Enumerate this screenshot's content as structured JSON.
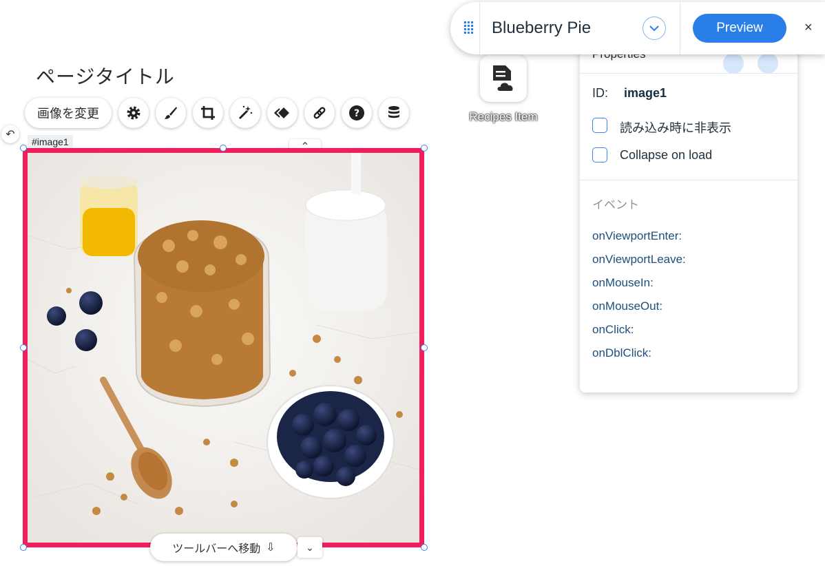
{
  "page": {
    "title": "ページタイトル"
  },
  "toolbar": {
    "change_image_label": "画像を変更",
    "icons": [
      "gear-icon",
      "brush-icon",
      "crop-icon",
      "magic-wand-icon",
      "animation-icon",
      "link-icon",
      "help-icon",
      "database-icon"
    ]
  },
  "element": {
    "id_tag": "#image1",
    "bottom_pill_label": "ツールバーへ移動",
    "selection_color": "#f31d5b"
  },
  "dataset": {
    "label": "Recipes Item",
    "icon": "document-cloud-icon"
  },
  "topbar": {
    "title": "Blueberry Pie",
    "preview_label": "Preview",
    "close_label": "×",
    "accent": "#2a7ee8"
  },
  "properties": {
    "title": "Properties",
    "id_label": "ID:",
    "id_value": "image1",
    "checkboxes": [
      {
        "label": "読み込み時に非表示",
        "checked": false
      },
      {
        "label": "Collapse on load",
        "checked": false
      }
    ],
    "events_title": "イベント",
    "events": [
      "onViewportEnter:",
      "onViewportLeave:",
      "onMouseIn:",
      "onMouseOut:",
      "onClick:",
      "onDblClick:"
    ]
  }
}
